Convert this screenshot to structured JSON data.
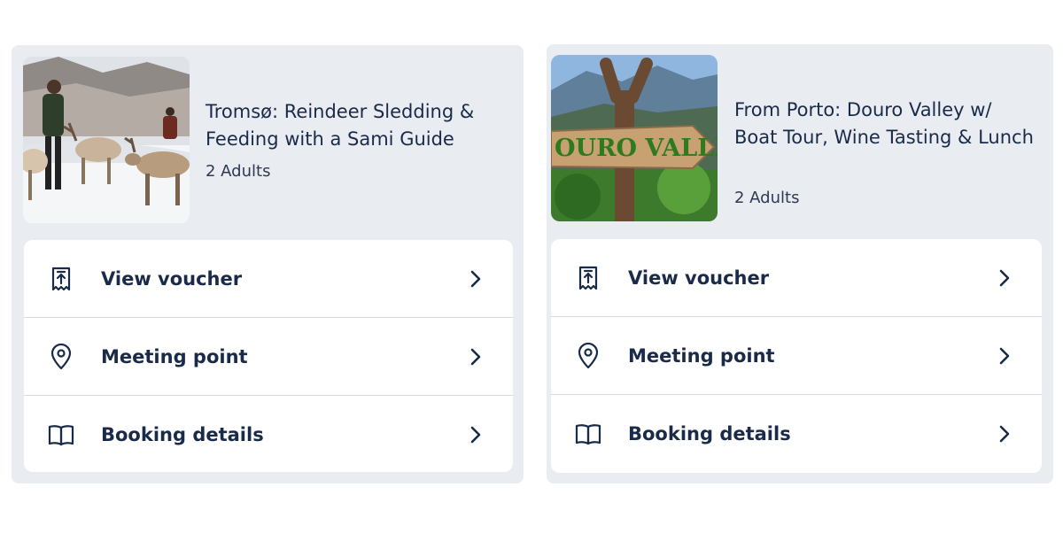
{
  "bookings": [
    {
      "title": "Tromsø: Reindeer Sledding & Feeding with a Sami Guide",
      "guests": "2 Adults",
      "image_icon": "reindeer-photo"
    },
    {
      "title": "From Porto: Douro Valley w/ Boat Tour, Wine Tasting & Lunch",
      "guests": "2 Adults",
      "image_icon": "douro-valley-sign-photo",
      "image_sign_text": "OURO VALLEY"
    }
  ],
  "menu": {
    "voucher": "View voucher",
    "meeting": "Meeting point",
    "details": "Booking details"
  },
  "icons": {
    "voucher": "ticket-icon",
    "meeting": "location-pin-icon",
    "details": "book-icon",
    "chevron": "chevron-right-icon"
  },
  "colors": {
    "card_bg": "#e9ecf1",
    "text": "#1a2b49",
    "divider": "#d7dbe2"
  }
}
